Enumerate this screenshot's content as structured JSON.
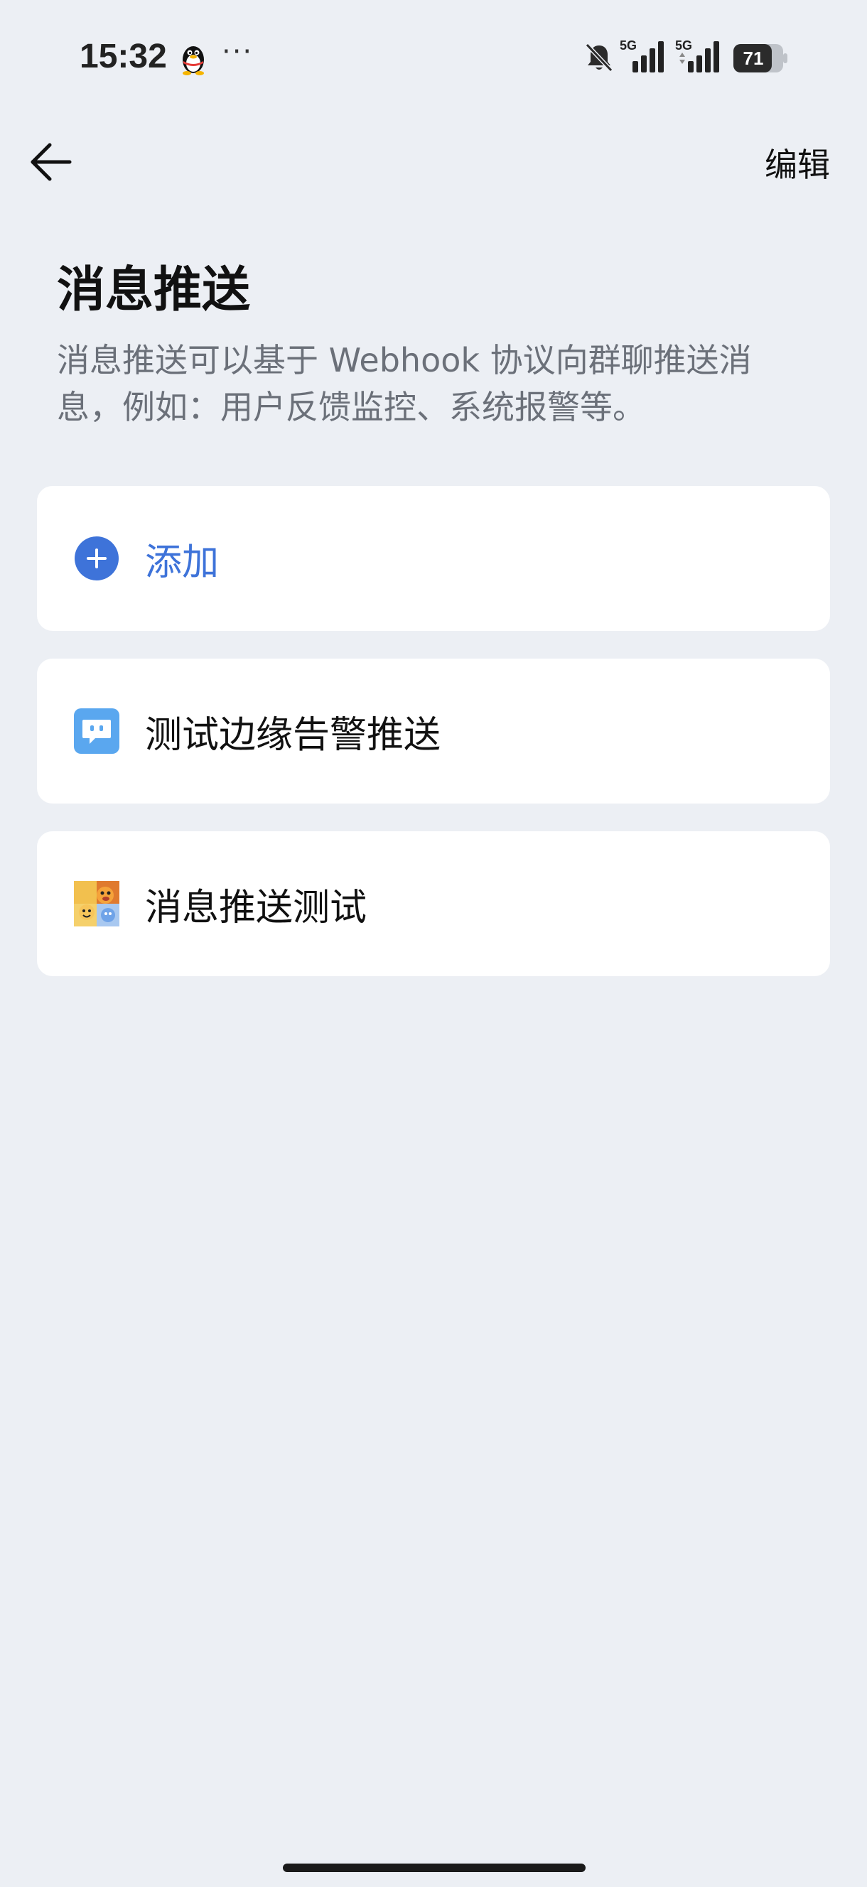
{
  "status_bar": {
    "time": "15:32",
    "dots": "···",
    "network_1": "5G",
    "network_2": "5G",
    "battery": "71"
  },
  "header": {
    "back_icon": "arrow-left-icon",
    "edit_label": "编辑"
  },
  "page": {
    "title": "消息推送",
    "description": "消息推送可以基于 Webhook 协议向群聊推送消息，例如：用户反馈监控、系统报警等。"
  },
  "list": {
    "add_label": "添加",
    "items": [
      {
        "label": "测试边缘告警推送",
        "icon": "chat-bubble-icon"
      },
      {
        "label": "消息推送测试",
        "icon": "group-avatar-icon"
      }
    ]
  },
  "colors": {
    "background": "#ECEFF4",
    "accent": "#3E73D9",
    "card": "#FFFFFF",
    "description_text": "#6B7079",
    "chat_icon": "#5AA7EF"
  }
}
